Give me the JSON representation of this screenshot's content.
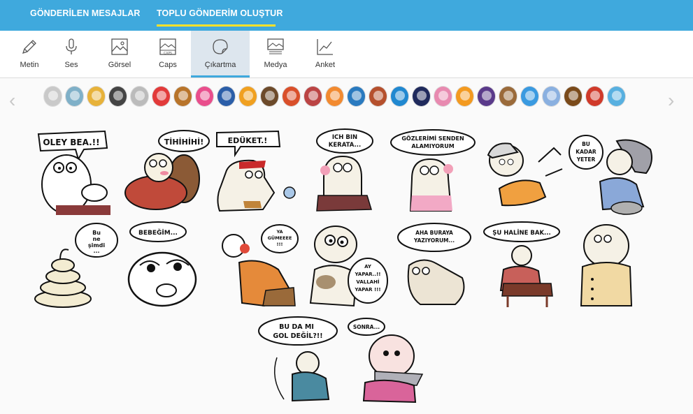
{
  "tabs": {
    "sent": "GÖNDERİLEN MESAJLAR",
    "bulk": "TOPLU GÖNDERİM OLUŞTUR"
  },
  "toolbar": {
    "items": [
      {
        "label": "Metin",
        "icon": "pencil-icon"
      },
      {
        "label": "Ses",
        "icon": "microphone-icon"
      },
      {
        "label": "Görsel",
        "icon": "image-icon"
      },
      {
        "label": "Caps",
        "icon": "caps-icon"
      },
      {
        "label": "Çıkartma",
        "icon": "sticker-icon"
      },
      {
        "label": "Medya",
        "icon": "media-icon"
      },
      {
        "label": "Anket",
        "icon": "chart-icon"
      }
    ],
    "active": "Çıkartma",
    "caps_icon_text": "CAPS"
  },
  "pack_colors": [
    "#c9c9c9",
    "#7fb0c8",
    "#e7b23a",
    "#444444",
    "#bbbbbb",
    "#e23a3a",
    "#b8742a",
    "#e94e8c",
    "#2b5ea8",
    "#f0a020",
    "#6c4a2a",
    "#d94f2a",
    "#bb4444",
    "#f28a30",
    "#2a7abf",
    "#b5502d",
    "#2088d0",
    "#1f2a5c",
    "#e88ab0",
    "#f39a20",
    "#5a3a8a",
    "#9a6a3a",
    "#3a9ae0",
    "#8ab0e0",
    "#7a4a1a",
    "#d03a2a",
    "#58b0e0"
  ],
  "stickers": {
    "s1": "OLEY BEA.!!",
    "s2": "TİHİHİHİ!",
    "s3": "EDÜKET.!",
    "s4a": "ICH BIN",
    "s4b": "KERATA...",
    "s5a": "GÖZLERİMİ SENDEN",
    "s5b": "ALAMIYORUM",
    "s6": "",
    "s7a": "BU",
    "s7b": "KADAR",
    "s7c": "YETER",
    "s8a": "Bu",
    "s8b": "ne",
    "s8c": "şimdi",
    "s8d": "...",
    "s9": "BEBEĞİM...",
    "s10a": "YA",
    "s10b": "GÜMEEEE",
    "s10c": "!!!",
    "s11a": "AY",
    "s11b": "YAPAR..!!",
    "s11c": "VALLAHİ",
    "s11d": "YAPAR !!!",
    "s12a": "AHA BURAYA",
    "s12b": "YAZIYORUM...",
    "s13": "ŞU HALİNE BAK...",
    "s14": "",
    "s15a": "BU DA MI",
    "s15b": "GOL DEĞİL?!!",
    "s16": "SONRA..."
  }
}
